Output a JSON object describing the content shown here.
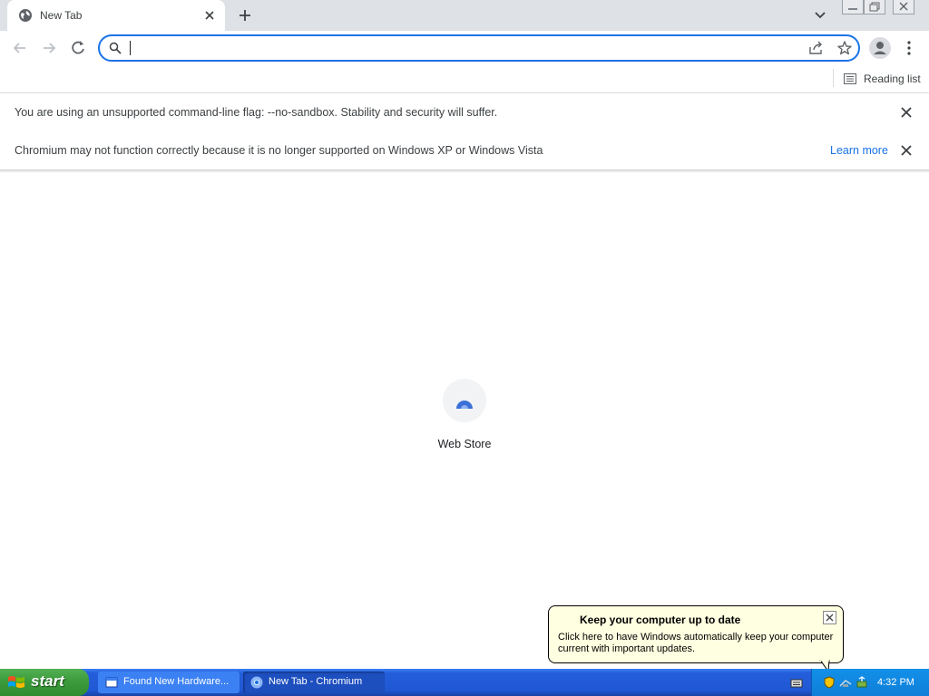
{
  "browser": {
    "tab_title": "New Tab",
    "omnibox_value": "",
    "reading_list_label": "Reading list"
  },
  "infobars": [
    {
      "message": "You are using an unsupported command-line flag: --no-sandbox. Stability and security will suffer."
    },
    {
      "message": "Chromium may not function correctly because it is no longer supported on Windows XP or Windows Vista",
      "link": "Learn more"
    }
  ],
  "shortcuts": [
    {
      "label": "Web Store"
    }
  ],
  "balloon": {
    "title": "Keep your computer up to date",
    "body": "Click here to have Windows automatically keep your computer current with important updates."
  },
  "taskbar": {
    "start_label": "start",
    "items": [
      {
        "label": "Found New Hardware..."
      },
      {
        "label": "New Tab - Chromium"
      }
    ],
    "clock": "4:32 PM"
  },
  "colors": {
    "accent": "#1a73e8",
    "tabstrip": "#dee1e6",
    "taskbar": "#245edb",
    "start": "#3c9b3c",
    "balloon": "#ffffe1"
  },
  "icons": [
    "globe-icon",
    "close-icon",
    "plus-icon",
    "chevron-down-icon",
    "back-icon",
    "forward-icon",
    "reload-icon",
    "search-icon",
    "share-icon",
    "star-icon",
    "profile-icon",
    "kebab-menu-icon",
    "reading-list-icon",
    "webstore-icon",
    "shield-icon",
    "windows-flag-icon"
  ]
}
